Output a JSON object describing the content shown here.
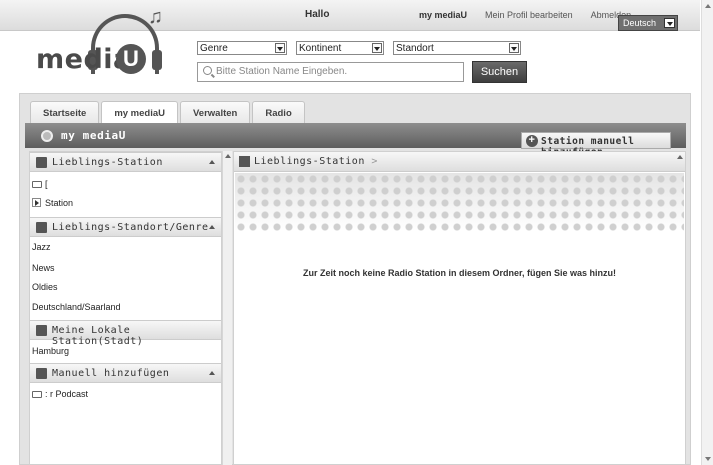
{
  "topbar": {
    "greeting": "Hallo",
    "nav": [
      "my mediaU",
      "Mein Profil bearbeiten",
      "Abmelden"
    ],
    "language": "Deutsch"
  },
  "logo": {
    "text_left": "medi",
    "text_mid": "a",
    "u": "U"
  },
  "search": {
    "genre": "Genre",
    "continent": "Kontinent",
    "location": "Standort",
    "placeholder": "Bitte Station Name Eingeben.",
    "button": "Suchen"
  },
  "tabs": [
    "Startseite",
    "my mediaU",
    "Verwalten",
    "Radio"
  ],
  "section_title": "my mediaU",
  "add_station_button": "Station manuell hinzufügen",
  "sidebar": {
    "favorites": {
      "title": "Lieblings-Station",
      "folder": "[",
      "station": "Station"
    },
    "locations": {
      "title": "Lieblings-Standort/Genre",
      "items": [
        "Jazz",
        "News",
        "Oldies",
        "Deutschland/Saarland"
      ]
    },
    "local": {
      "title": "Meine Lokale Station(Stadt)",
      "items": [
        "Hamburg"
      ]
    },
    "manual": {
      "title": "Manuell hinzufügen",
      "folder": ": r Podcast"
    }
  },
  "content": {
    "breadcrumb": "Lieblings-Station",
    "breadcrumb_sep": ">",
    "empty_message": "Zur Zeit noch keine Radio Station in diesem Ordner, fügen Sie was hinzu!"
  }
}
